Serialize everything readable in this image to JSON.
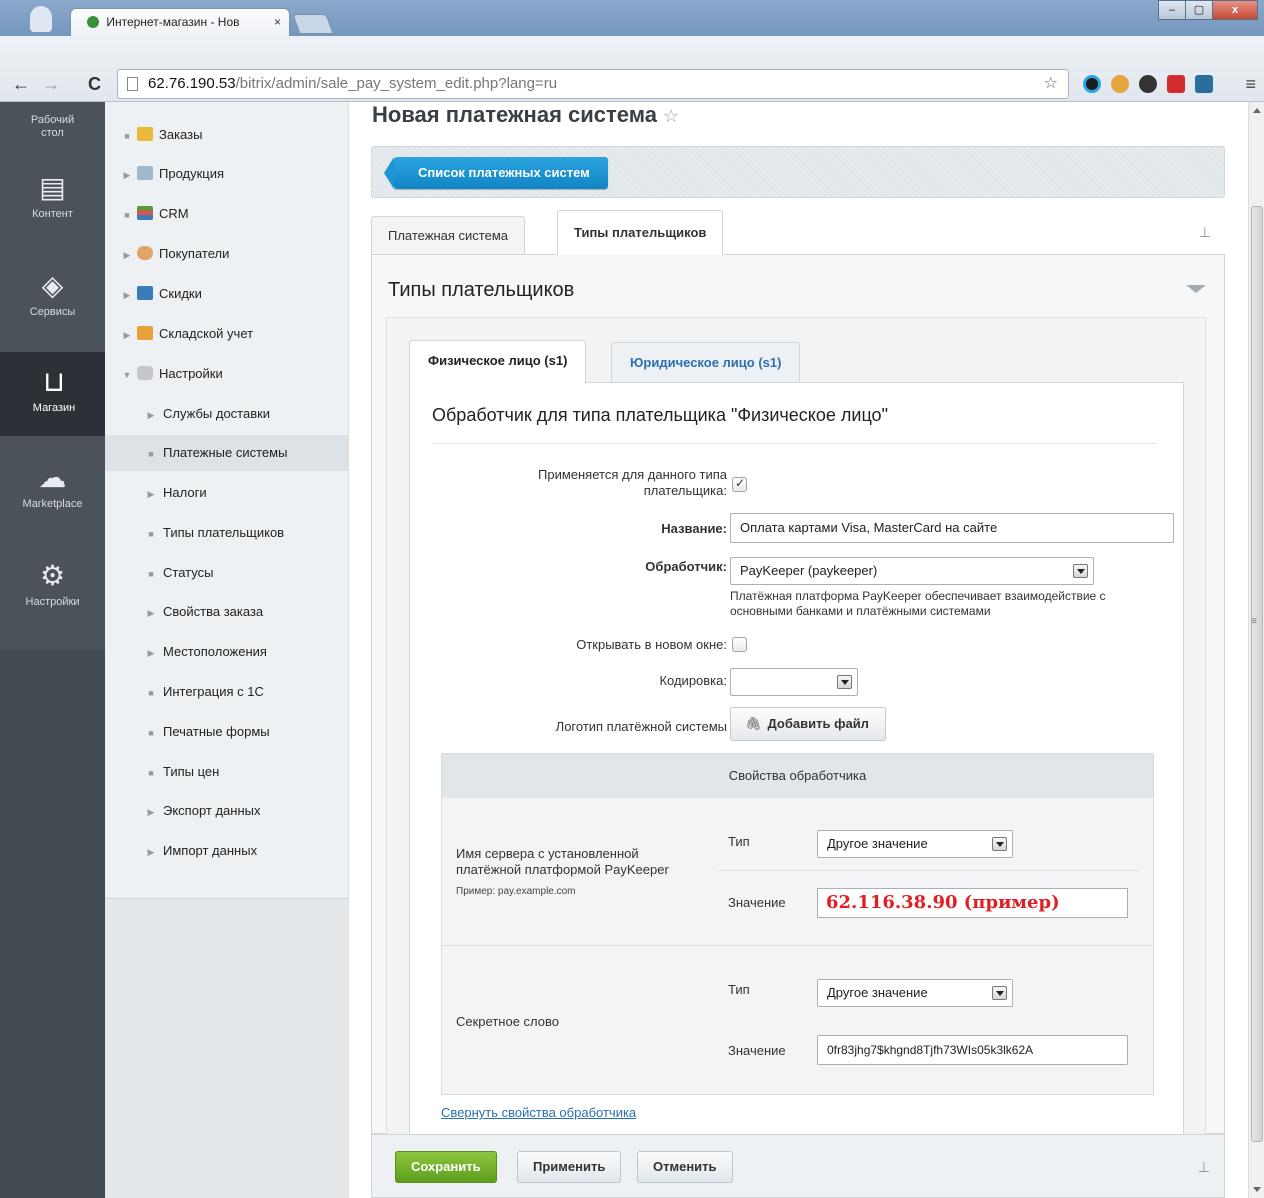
{
  "browser": {
    "tab_title": "Интернет-магазин - Нов",
    "tab_close": "×",
    "url_host": "62.76.190.53",
    "url_path": "/bitrix/admin/sale_pay_system_edit.php?lang=ru",
    "back": "←",
    "forward": "→",
    "reload": "C",
    "bookmark_star": "☆",
    "menu": "≡",
    "win_min": "–",
    "win_max": "▢",
    "win_close": "x"
  },
  "rail": {
    "items": [
      {
        "label": "Рабочий стол",
        "icon": "desktop-icon"
      },
      {
        "label": "Контент",
        "icon": "document-icon",
        "glyph": "▤"
      },
      {
        "label": "Сервисы",
        "icon": "layers-icon",
        "glyph": "◈"
      },
      {
        "label": "Магазин",
        "icon": "basket-icon",
        "glyph": "⊔",
        "active": true
      },
      {
        "label": "Marketplace",
        "icon": "cloud-download-icon",
        "glyph": "☁"
      },
      {
        "label": "Настройки",
        "icon": "gear-icon",
        "glyph": "⚙"
      }
    ]
  },
  "submenu": {
    "items": [
      {
        "label": "Заказы",
        "marker": "■"
      },
      {
        "label": "Продукция",
        "marker": "▶"
      },
      {
        "label": "CRM",
        "marker": "■"
      },
      {
        "label": "Покупатели",
        "marker": "▶"
      },
      {
        "label": "Скидки",
        "marker": "▶"
      },
      {
        "label": "Складской учет",
        "marker": "▶"
      },
      {
        "label": "Настройки",
        "marker": "▼"
      },
      {
        "label": "Службы доставки",
        "marker": "▶"
      },
      {
        "label": "Платежные системы",
        "marker": "■"
      },
      {
        "label": "Налоги",
        "marker": "▶"
      },
      {
        "label": "Типы плательщиков",
        "marker": "■"
      },
      {
        "label": "Статусы",
        "marker": "■"
      },
      {
        "label": "Свойства заказа",
        "marker": "▶"
      },
      {
        "label": "Местоположения",
        "marker": "▶"
      },
      {
        "label": "Интеграция с 1С",
        "marker": "■"
      },
      {
        "label": "Печатные формы",
        "marker": "■"
      },
      {
        "label": "Типы цен",
        "marker": "■"
      },
      {
        "label": "Экспорт данных",
        "marker": "▶"
      },
      {
        "label": "Импорт данных",
        "marker": "▶"
      }
    ]
  },
  "page": {
    "title": "Новая платежная система",
    "star": "☆",
    "context_button": "Список платежных систем",
    "tabs": [
      "Платежная система",
      "Типы плательщиков"
    ],
    "pin": "⊥",
    "panel_title": "Типы плательщиков",
    "subtabs": [
      "Физическое лицо (s1)",
      "Юридическое лицо (s1)"
    ],
    "form": {
      "heading": "Обработчик для типа плательщика \"Физическое лицо\"",
      "applies_label_line1": "Применяется для данного типа",
      "applies_label_line2": "плательщика:",
      "name_label": "Название:",
      "name_value": "Оплата картами Visa, MasterCard на сайте",
      "handler_label": "Обработчик:",
      "handler_value": "PayKeeper (paykeeper)",
      "handler_hint_line1": "Платёжная платформа PayKeeper обеспечивает взаимодействие с",
      "handler_hint_line2": "основными банками и платёжными системами",
      "new_window_label": "Открывать в новом окне:",
      "encoding_label": "Кодировка:",
      "encoding_value": "",
      "logo_label": "Логотип платёжной системы",
      "add_file_icon": "🖇",
      "add_file": "Добавить файл"
    },
    "props": {
      "title": "Свойства обработчика",
      "rows": [
        {
          "name_line1": "Имя сервера с установленной",
          "name_line2": "платёжной платформой PayKeeper",
          "example": "Пример: pay.example.com",
          "type_label": "Тип",
          "type_value": "Другое значение",
          "value_label": "Значение",
          "value": "62.116.38.90 (пример)"
        },
        {
          "name_line1": "Секретное слово",
          "type_label": "Тип",
          "type_value": "Другое значение",
          "value_label": "Значение",
          "value": "0fr83jhg7$khgnd8Tjfh73WIs05k3lk62A"
        }
      ]
    },
    "collapse_link": "Свернуть свойства обработчика",
    "footer": {
      "save": "Сохранить",
      "apply": "Применить",
      "cancel": "Отменить"
    }
  },
  "colors": {
    "save_green": "#6aab24",
    "context_blue": "#1b94d6",
    "highlight_red": "#e01e24",
    "rail_dark": "#4b525a"
  }
}
